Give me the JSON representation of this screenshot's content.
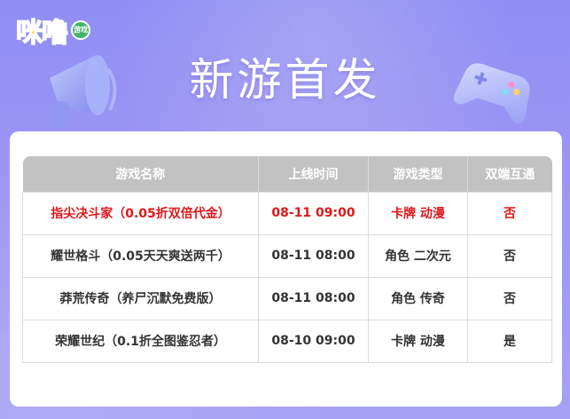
{
  "logo": {
    "text": "咪噜",
    "badge": "游戏"
  },
  "page_title": "新游首发",
  "colors": {
    "highlight": "#e0161a",
    "header_bg": "#c2c2c2",
    "page_bg": "#9c96f4"
  },
  "table": {
    "headers": [
      "游戏名称",
      "上线时间",
      "游戏类型",
      "双端互通"
    ],
    "rows": [
      {
        "name": "指尖决斗家（0.05折双倍代金）",
        "time": "08-11 09:00",
        "type": "卡牌 动漫",
        "cross": "否",
        "highlight": true
      },
      {
        "name": "耀世格斗（0.05天天爽送两千）",
        "time": "08-11 08:00",
        "type": "角色 二次元",
        "cross": "否",
        "highlight": false
      },
      {
        "name": "莽荒传奇（养尸沉默免费版）",
        "time": "08-11 08:00",
        "type": "角色 传奇",
        "cross": "否",
        "highlight": false
      },
      {
        "name": "荣耀世纪（0.1折全图鉴忍者）",
        "time": "08-10 09:00",
        "type": "卡牌 动漫",
        "cross": "是",
        "highlight": false
      }
    ]
  }
}
